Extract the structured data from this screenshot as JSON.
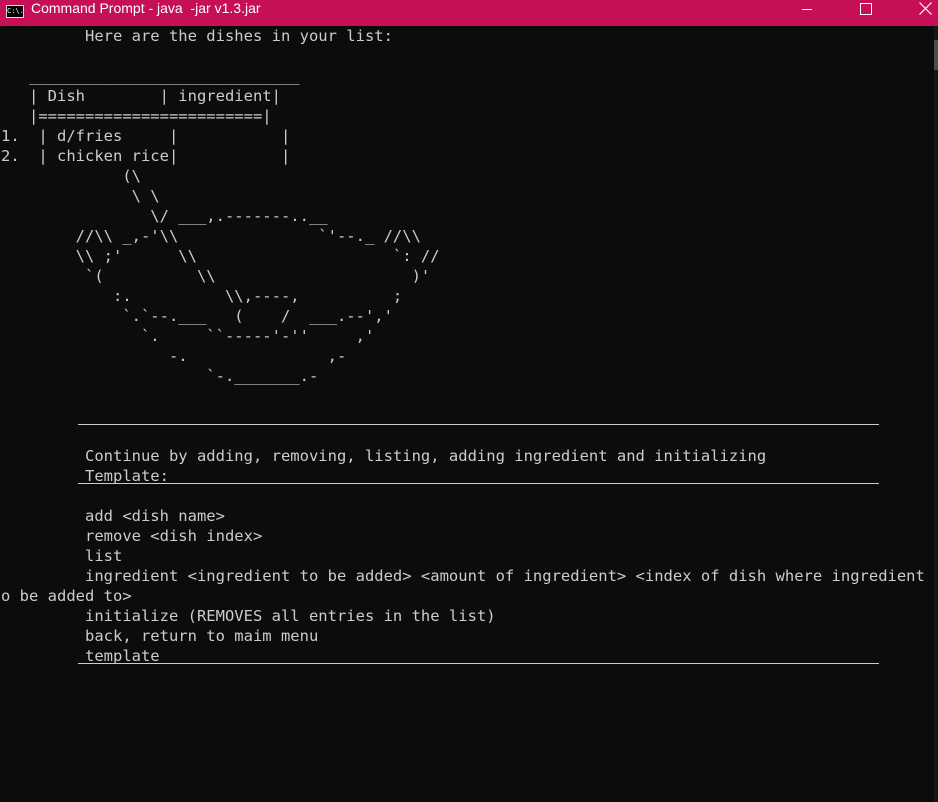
{
  "window": {
    "title": "Command Prompt - java  -jar v1.3.jar",
    "icon_label": "C:\\.",
    "titlebar_color": "#c50f57",
    "text_color": "#cccccc",
    "background_color": "#0c0c0c",
    "icons": {
      "minimize": "minimize-icon",
      "maximize": "maximize-icon",
      "close": "close-icon"
    }
  },
  "console": {
    "lines": [
      "         Here are the dishes in your list:",
      "",
      "   _____________________________",
      "   | Dish        | ingredient|",
      "   |========================|",
      "1.  | d/fries     |           |",
      "2.  | chicken rice|           |",
      "             (\\",
      "              \\ \\",
      "                \\/ ___,.-------..__",
      "        //\\\\ _,-'\\\\               `'--._ //\\\\",
      "        \\\\ ;'      \\\\                     `: //",
      "         `(          \\\\                     )'",
      "            :.          \\\\,----,          ;",
      "             `.`--.___   (    /  ___.--','",
      "               `.     ``-----'-''     ,'",
      "                  -.               ,-",
      "                      `-._______.-",
      "",
      "",
      "",
      "         Continue by adding, removing, listing, adding ingredient and initializing",
      "         Template:",
      "",
      "         add <dish name>",
      "         remove <dish index>",
      "         list",
      "         ingredient <ingredient to be added> <amount of ingredient> <index of dish where ingredient is t",
      "o be added to>",
      "         initialize (REMOVES all entries in the list)",
      "         back, return to maim menu",
      "         template"
    ]
  }
}
